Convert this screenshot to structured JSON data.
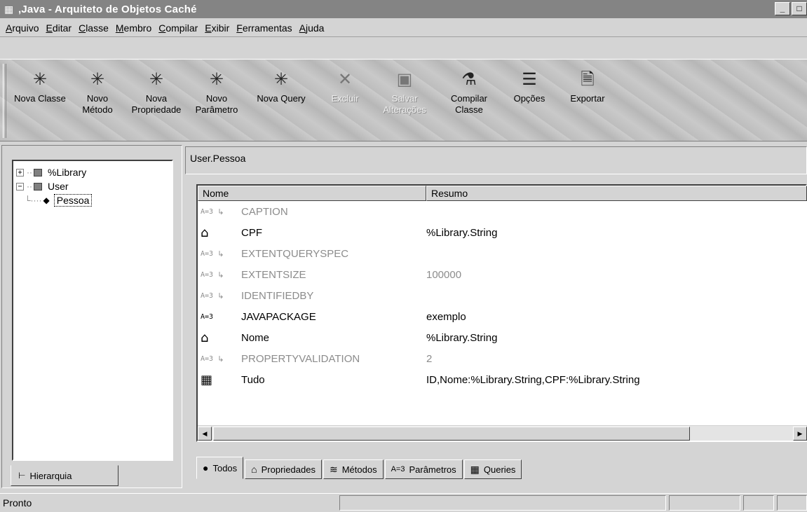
{
  "window": {
    "title": ",Java - Arquiteto de Objetos Caché",
    "app_icon": "grid-icon",
    "controls": [
      "minimize",
      "maximize"
    ]
  },
  "menu": [
    "Arquivo",
    "Editar",
    "Classe",
    "Membro",
    "Compilar",
    "Exibir",
    "Ferramentas",
    "Ajuda"
  ],
  "toolbar": [
    {
      "l1": "Nova Classe",
      "l2": "",
      "icon": "new-class-icon",
      "glyph": "✳",
      "enabled": true
    },
    {
      "l1": "Novo",
      "l2": "Método",
      "icon": "new-method-icon",
      "glyph": "✳",
      "enabled": true
    },
    {
      "l1": "Nova",
      "l2": "Propriedade",
      "icon": "new-property-icon",
      "glyph": "✳",
      "enabled": true
    },
    {
      "l1": "Novo",
      "l2": "Parâmetro",
      "icon": "new-parameter-icon",
      "glyph": "✳",
      "enabled": true
    },
    {
      "l1": "Nova Query",
      "l2": "",
      "icon": "new-query-icon",
      "glyph": "✳",
      "enabled": true
    },
    {
      "l1": "Excluir",
      "l2": "",
      "icon": "delete-icon",
      "glyph": "✕",
      "enabled": false
    },
    {
      "l1": "Salvar",
      "l2": "Alterações",
      "icon": "save-icon",
      "glyph": "▣",
      "enabled": false
    },
    {
      "l1": "Compilar",
      "l2": "Classe",
      "icon": "compile-icon",
      "glyph": "⚗",
      "enabled": true
    },
    {
      "l1": "Opções",
      "l2": "",
      "icon": "options-icon",
      "glyph": "☰",
      "enabled": true
    },
    {
      "l1": "Exportar",
      "l2": "",
      "icon": "export-icon",
      "glyph": "🗎",
      "enabled": true
    }
  ],
  "tree": {
    "nodes": [
      {
        "label": "%Library",
        "expander": "+",
        "level": 0
      },
      {
        "label": "User",
        "expander": "−",
        "level": 0
      },
      {
        "label": "Pessoa",
        "expander": "",
        "level": 1,
        "selected": true
      }
    ],
    "tab_label": "Hierarquia"
  },
  "class_name": "User.Pessoa",
  "list": {
    "columns": [
      "Nome",
      "Resumo"
    ],
    "rows": [
      {
        "kind": "parameter",
        "inherited": true,
        "name": "CAPTION",
        "summary": ""
      },
      {
        "kind": "property",
        "inherited": false,
        "name": "CPF",
        "summary": "%Library.String"
      },
      {
        "kind": "parameter",
        "inherited": true,
        "name": "EXTENTQUERYSPEC",
        "summary": ""
      },
      {
        "kind": "parameter",
        "inherited": true,
        "name": "EXTENTSIZE",
        "summary": "100000"
      },
      {
        "kind": "parameter",
        "inherited": true,
        "name": "IDENTIFIEDBY",
        "summary": ""
      },
      {
        "kind": "parameter",
        "inherited": false,
        "name": "JAVAPACKAGE",
        "summary": "exemplo"
      },
      {
        "kind": "property",
        "inherited": false,
        "name": "Nome",
        "summary": "%Library.String"
      },
      {
        "kind": "parameter",
        "inherited": true,
        "name": "PROPERTYVALIDATION",
        "summary": "2"
      },
      {
        "kind": "query",
        "inherited": false,
        "name": "Tudo",
        "summary": "ID,Nome:%Library.String,CPF:%Library.String"
      }
    ],
    "param_glyph": "A=3",
    "inherited_glyph": "↳"
  },
  "tabs": [
    {
      "label": "Todos",
      "icon": "globe-icon",
      "glyph": "●",
      "active": true
    },
    {
      "label": "Propriedades",
      "icon": "house-icon",
      "glyph": "⌂",
      "active": false
    },
    {
      "label": "Métodos",
      "icon": "method-icon",
      "glyph": "≋",
      "active": false
    },
    {
      "label": "Parâmetros",
      "icon": "parameter-icon",
      "glyph": "A=3",
      "active": false
    },
    {
      "label": "Queries",
      "icon": "query-icon",
      "glyph": "▦",
      "active": false
    }
  ],
  "status": "Pronto"
}
